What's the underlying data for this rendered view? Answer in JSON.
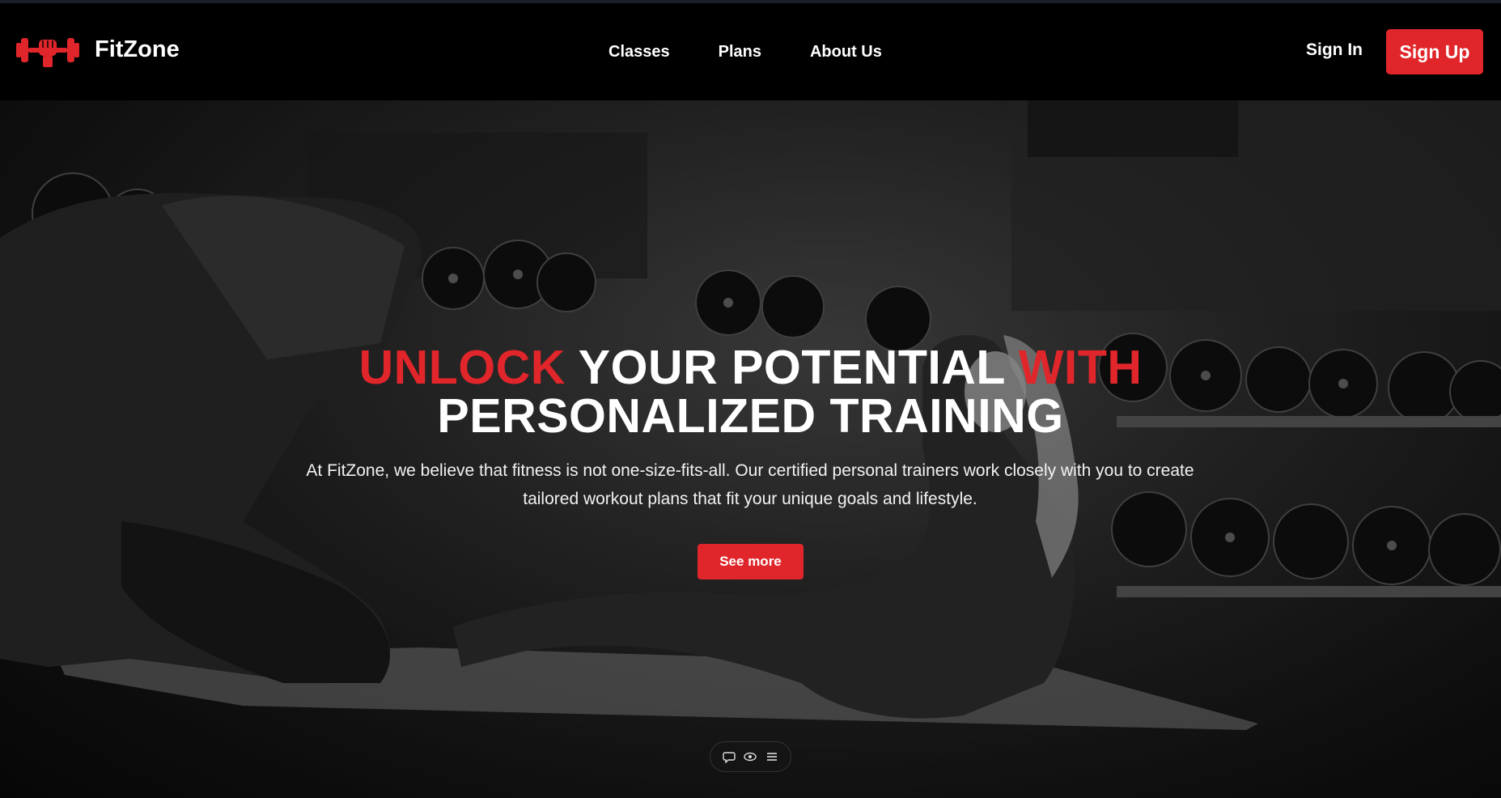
{
  "brand": {
    "name": "FitZone",
    "logo_icon": "dumbbell-fist-logo",
    "accent": "#e0262b"
  },
  "nav": {
    "links": [
      "Classes",
      "Plans",
      "About Us"
    ],
    "signin_label": "Sign In",
    "signup_label": "Sign Up"
  },
  "hero": {
    "headline_red_1": "UNLOCK",
    "headline_white_1": "YOUR POTENTIAL",
    "headline_red_2": "WITH",
    "headline_line2": "PERSONALIZED TRAINING",
    "description": "At FitZone, we believe that fitness is not one-size-fits-all. Our certified personal trainers work closely with you to create tailored workout plans that fit your unique goals and lifestyle.",
    "cta_label": "See more",
    "background_image": "gym-trainer-and-woman-doing-situps"
  },
  "dock": {
    "icons": [
      "chat-icon",
      "eye-icon",
      "menu-icon"
    ]
  }
}
